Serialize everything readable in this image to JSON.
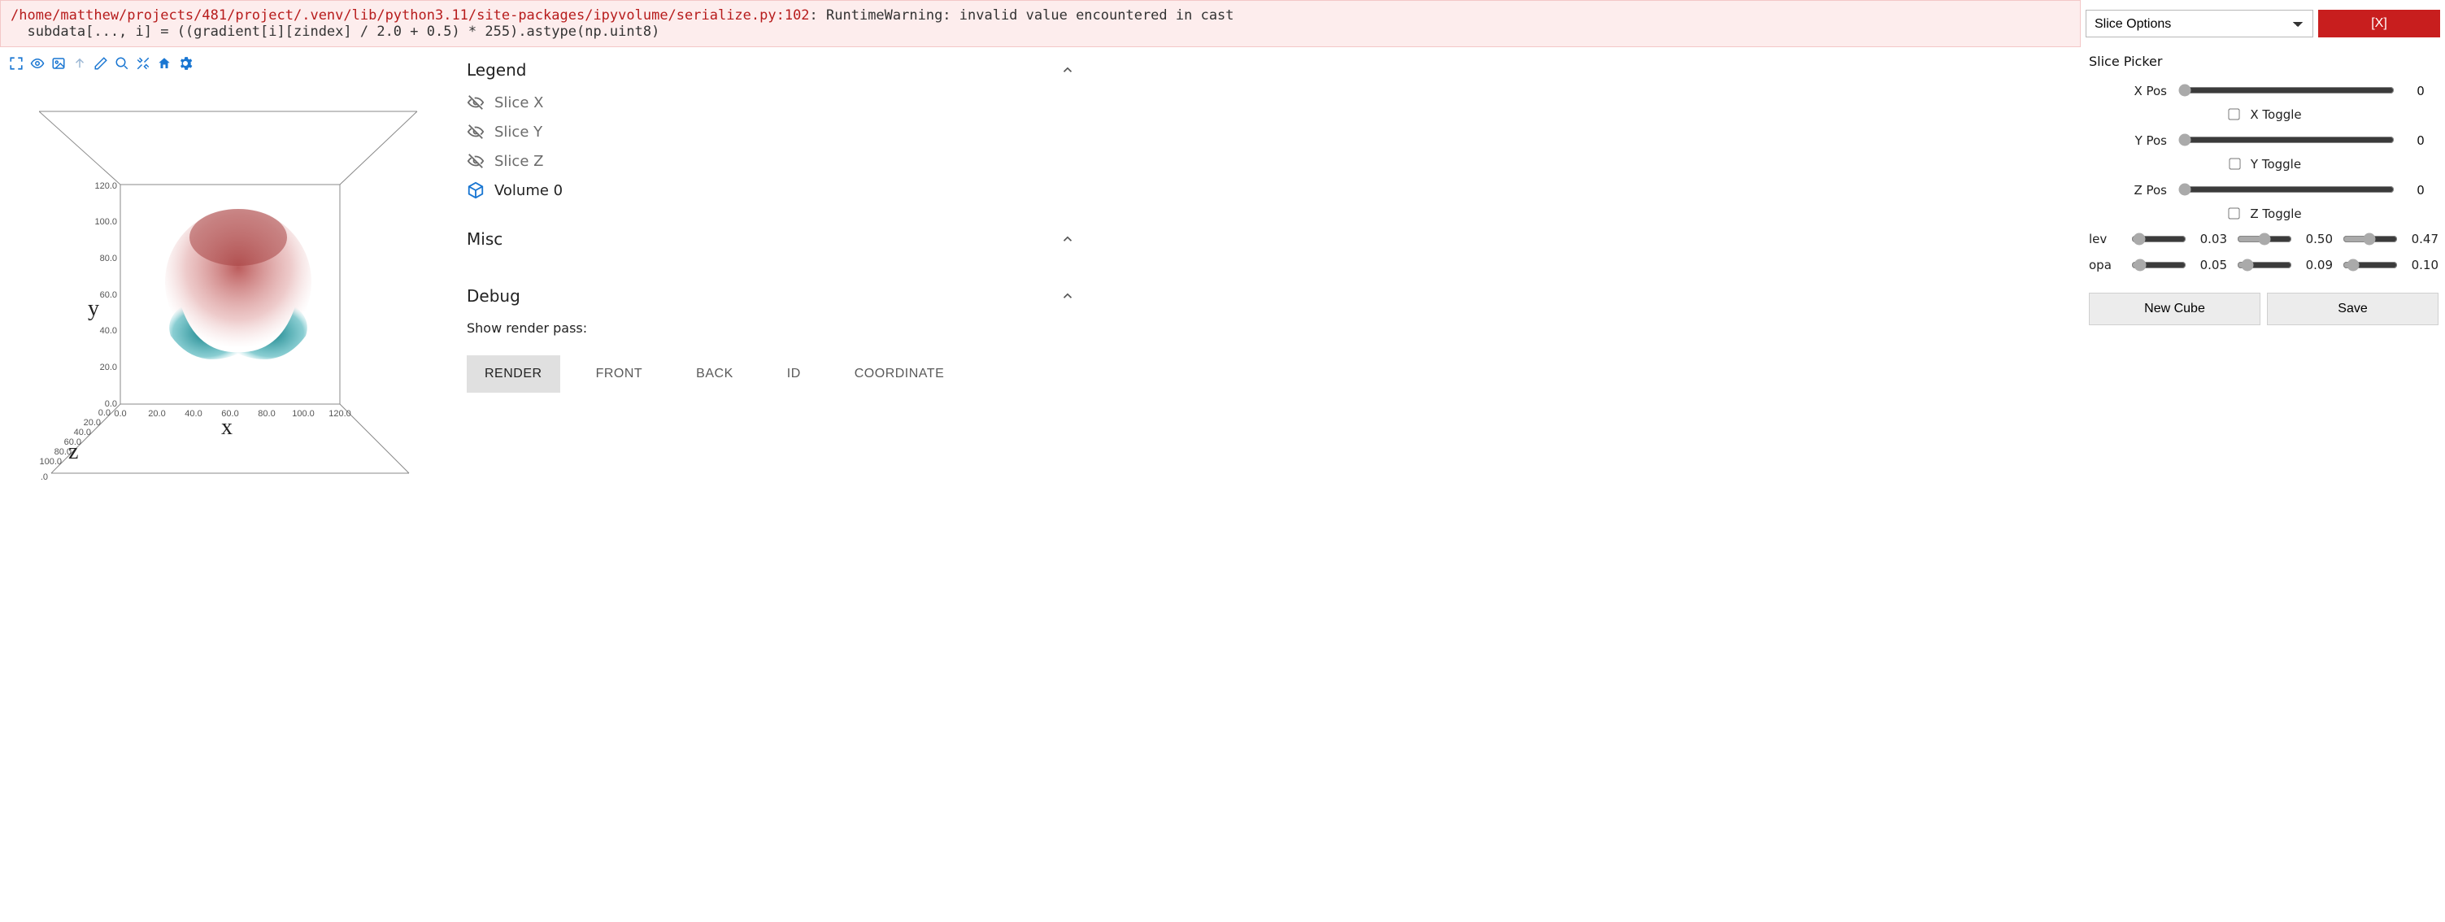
{
  "warning": {
    "path": "/home/matthew/projects/481/project/.venv/lib/python3.11/site-packages/ipyvolume/serialize.py:102",
    "suffix": ": RuntimeWarning: invalid value encountered in cast",
    "code": "  subdata[..., i] = ((gradient[i][zindex] / 2.0 + 0.5) * 255).astype(np.uint8)"
  },
  "top": {
    "dropdown": "Slice Options",
    "close": "[X]"
  },
  "plot": {
    "axis_x": "x",
    "axis_y": "y",
    "axis_z": "z",
    "ticks_x": [
      "0.0",
      "20.0",
      "40.0",
      "60.0",
      "80.0",
      "100.0",
      "120.0"
    ],
    "ticks_y": [
      "0.0",
      "20.0",
      "40.0",
      "60.0",
      "80.0",
      "100.0",
      "120.0"
    ],
    "ticks_z": [
      "0.0",
      "20.0",
      "40.0",
      "60.0",
      "80.0",
      "100.0",
      ".0"
    ]
  },
  "panels": {
    "legend": {
      "title": "Legend",
      "items": [
        {
          "label": "Slice X",
          "on": false
        },
        {
          "label": "Slice Y",
          "on": false
        },
        {
          "label": "Slice Z",
          "on": false
        },
        {
          "label": "Volume 0",
          "on": true
        }
      ]
    },
    "misc": {
      "title": "Misc"
    },
    "debug": {
      "title": "Debug",
      "render_label": "Show render pass:",
      "tabs": [
        "RENDER",
        "FRONT",
        "BACK",
        "ID",
        "COORDINATE"
      ],
      "active_tab": 0
    }
  },
  "right": {
    "title": "Slice Picker",
    "pos": {
      "x": {
        "label": "X Pos",
        "value": "0",
        "toggle_label": "X Toggle",
        "toggle": false
      },
      "y": {
        "label": "Y Pos",
        "value": "0",
        "toggle_label": "Y Toggle",
        "toggle": false
      },
      "z": {
        "label": "Z Pos",
        "value": "0",
        "toggle_label": "Z Toggle",
        "toggle": false
      }
    },
    "levels": {
      "label": "lev",
      "v1": "0.03",
      "v2": "0.50",
      "v3": "0.47"
    },
    "opacities": {
      "label": "opa",
      "v1": "0.05",
      "v2": "0.09",
      "v3": "0.10"
    },
    "buttons": {
      "new_cube": "New Cube",
      "save": "Save"
    }
  }
}
